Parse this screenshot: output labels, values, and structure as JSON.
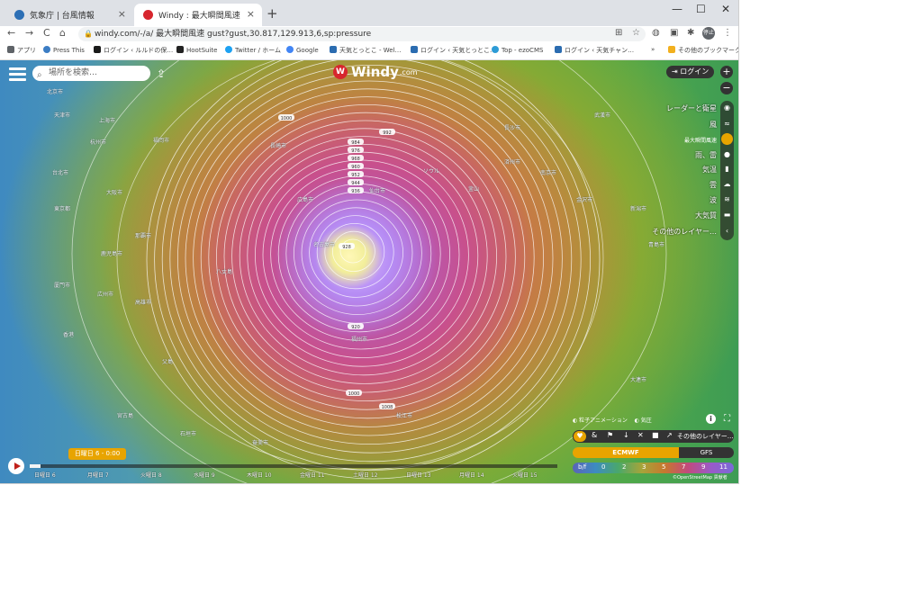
{
  "browser": {
    "tabs": [
      {
        "title": "気象庁 | 台風情報",
        "close": "×"
      },
      {
        "title": "Windy : 最大瞬間風速",
        "close": "×"
      }
    ],
    "new_tab": "+",
    "window_controls": {
      "minimize": "—",
      "maximize": "☐",
      "close": "✕"
    },
    "nav": {
      "back": "←",
      "forward": "→",
      "reload": "C",
      "home": "⌂"
    },
    "url": "windy.com/-/a/ 最大瞬間風速 gust?gust,30.817,129.913,6,sp:pressure",
    "profile": "停止",
    "bookmarks": [
      {
        "label": "アプリ",
        "color": "#5f6368"
      },
      {
        "label": "Press This",
        "color": "#3c7dc4"
      },
      {
        "label": "ログイン ‹ ルルドの保…",
        "color": "#1a1a1a"
      },
      {
        "label": "HootSuite",
        "color": "#222222"
      },
      {
        "label": "Twitter / ホーム",
        "color": "#1da1f2"
      },
      {
        "label": "Google",
        "color": "#4285f4"
      },
      {
        "label": "天気とっとこ - Wel…",
        "color": "#2b6cb0"
      },
      {
        "label": "ログイン ‹ 天気とっとこ…",
        "color": "#2b6cb0"
      },
      {
        "label": "Top - ezoCMS",
        "color": "#2d9bd6"
      },
      {
        "label": "ログイン ‹ 天気チャン…",
        "color": "#2b6cb0"
      },
      {
        "label": "»",
        "color": "#ffffff"
      },
      {
        "label": "その他のブックマーク",
        "color": "#f2b01e"
      }
    ]
  },
  "map": {
    "search_placeholder": "場所を検索…",
    "logo_text": "Windy",
    "logo_domain": ".com",
    "login_label": "ログイン",
    "zoom_in": "+",
    "zoom_out": "−",
    "layers": [
      "レーダーと衛星",
      "風",
      "最大瞬間風速",
      "雨、雷",
      "気温",
      "雲",
      "波",
      "大気質",
      "その他のレイヤー…"
    ],
    "options": {
      "particles": "粒子アニメーション",
      "pressure": "気圧"
    },
    "overlay_more": "その他のレイヤー…",
    "models": {
      "primary": "ECMWF",
      "secondary": "GFS"
    },
    "scale_unit": "b/f",
    "scale_values": [
      "0",
      "2",
      "3",
      "5",
      "7",
      "9",
      "11"
    ],
    "attribution": "©OpenStreetMap 貢献者",
    "current_time": "日曜日 6 - 0:00",
    "progress_percent": 2,
    "timeline_days": [
      "日曜日 6",
      "月曜日 7",
      "火曜日 8",
      "水曜日 9",
      "木曜日 10",
      "金曜日 11",
      "土曜日 12",
      "日曜日 13",
      "月曜日 14",
      "火曜日 15"
    ],
    "isobar_labels": [
      "1000",
      "992",
      "984",
      "976",
      "968",
      "960",
      "952",
      "944",
      "936",
      "928",
      "920",
      "1000",
      "1008"
    ],
    "cities": [
      "北京市",
      "天津市",
      "上海市",
      "杭州市",
      "台北市",
      "福岡市",
      "大阪市",
      "東京都",
      "那覇市",
      "鹿児島市",
      "長崎市",
      "広島市",
      "名古屋市",
      "仙台市",
      "ソウル",
      "釜山",
      "済州市",
      "南京市",
      "武漢市",
      "長沙市",
      "福州市",
      "厦門市",
      "広州市",
      "香港",
      "高雄市",
      "八丈島",
      "父島",
      "宮古島",
      "石垣市",
      "奄美市",
      "松江市",
      "金沢市",
      "新潟市",
      "青島市",
      "大連市"
    ]
  }
}
